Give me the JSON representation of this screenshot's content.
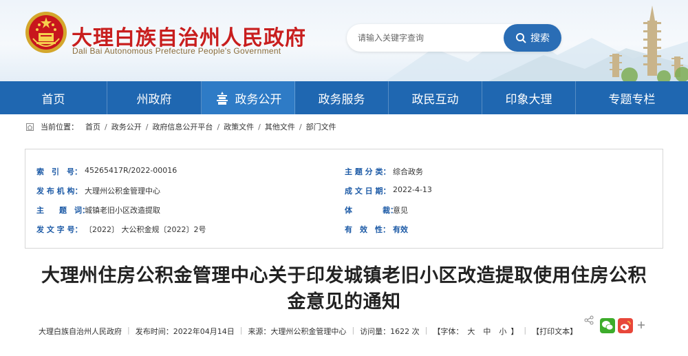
{
  "header": {
    "title": "大理白族自治州人民政府",
    "subtitle": "Dali Bai Autonomous Prefecture People's Government",
    "search_placeholder": "请输入关键字查询",
    "search_button": "搜索"
  },
  "nav": {
    "items": [
      "首页",
      "州政府",
      "政务公开",
      "政务服务",
      "政民互动",
      "印象大理",
      "专题专栏"
    ],
    "active_index": 2
  },
  "breadcrumb": {
    "prefix": "当前位置：",
    "items": [
      "首页",
      "政务公开",
      "政府信息公开平台",
      "政策文件",
      "其他文件",
      "部门文件"
    ],
    "separator": "/"
  },
  "info": {
    "index_label": "索　引　号：",
    "index_value": "45265417R/2022-00016",
    "topic_label": "主 题 分 类：",
    "topic_value": "综合政务",
    "publisher_label": "发 布 机 构：",
    "publisher_value": "大理州公积金管理中心",
    "date_label": "成 文 日 期：",
    "date_value": "2022-4-13",
    "keyword_label": "主　　题　词：",
    "keyword_value": "城镇老旧小区改造提取",
    "genre_label": "体　　　　裁：",
    "genre_value": "意见",
    "docno_label": "发 文 字 号：",
    "docno_value": "〔2022〕 大公积金规〔2022〕2号",
    "validity_label": "有　效　性：",
    "validity_value": "有效"
  },
  "document": {
    "title_line1": "大理州住房公积金管理中心关于印发城镇老旧小区改造提取使用住房公积",
    "title_line2": "金意见的通知"
  },
  "meta": {
    "source_org": "大理白族自治州人民政府",
    "publish_time": "发布时间：2022年04月14日",
    "source": "来源：大理州公积金管理中心",
    "views": "访问量：1622 次",
    "font_label": "【字体：",
    "font_large": "大",
    "font_medium": "中",
    "font_small": "小",
    "font_end": "】",
    "print": "【打印文本】"
  },
  "colors": {
    "nav_bg": "#1f67b1",
    "nav_active": "#2e7bc6",
    "title_red": "#c81e1e",
    "label_blue": "#1c5aa6",
    "search_btn": "#2a6db5"
  },
  "icons": {
    "emblem": "national-emblem-icon",
    "search": "search-icon",
    "home_crumb": "home-icon",
    "nav_active": "pagoda-icon",
    "share": "share-icon",
    "wechat": "wechat-icon",
    "weibo": "weibo-icon",
    "more": "plus-icon"
  }
}
